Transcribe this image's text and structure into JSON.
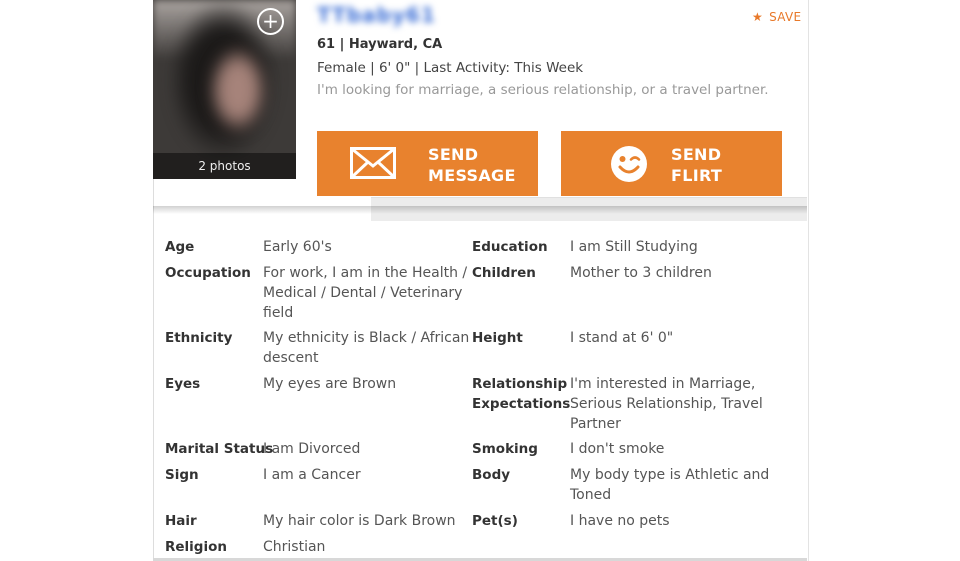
{
  "profile": {
    "username": "TTbaby61",
    "age_location": "61 | Hayward, CA",
    "summary": "Female | 6' 0\" | Last Activity: This Week",
    "seeking": "I'm looking for marriage, a serious relationship, or a travel partner.",
    "photos_caption": "2 photos",
    "save_label": "SAVE"
  },
  "actions": {
    "send_message": [
      "SEND",
      "MESSAGE"
    ],
    "send_flirt": [
      "SEND",
      "FLIRT"
    ]
  },
  "details": {
    "left": [
      {
        "label": "Age",
        "value": "Early 60's"
      },
      {
        "label": "Occupation",
        "value": [
          "For work, I am in the Health /",
          "Medical / Dental / Veterinary",
          "field"
        ]
      },
      {
        "label": "Ethnicity",
        "value": [
          "My ethnicity is Black / African",
          "descent"
        ]
      },
      {
        "label": "Eyes",
        "value": "My eyes are Brown"
      },
      {
        "label": "Marital Status",
        "value": "I am Divorced"
      },
      {
        "label": "Sign",
        "value": "I am a Cancer"
      },
      {
        "label": "Hair",
        "value": "My hair color is Dark Brown"
      },
      {
        "label": "Religion",
        "value": "Christian"
      }
    ],
    "right": [
      {
        "label": "Education",
        "value": "I am Still Studying"
      },
      {
        "label": "Children",
        "value": "Mother to 3 children"
      },
      {
        "label": "Height",
        "value": "I stand at 6' 0\""
      },
      {
        "label": [
          "Relationship",
          "Expectations"
        ],
        "value": [
          "I'm interested in Marriage,",
          "Serious Relationship, Travel",
          "Partner"
        ]
      },
      {
        "label": "Smoking",
        "value": "I don't smoke"
      },
      {
        "label": "Body",
        "value": [
          "My body type is Athletic and",
          "Toned"
        ]
      },
      {
        "label": "Pet(s)",
        "value": "I have no pets"
      }
    ]
  },
  "colors": {
    "accent": "#e8822e",
    "username": "#3c6fd6",
    "save": "#e8792a"
  }
}
